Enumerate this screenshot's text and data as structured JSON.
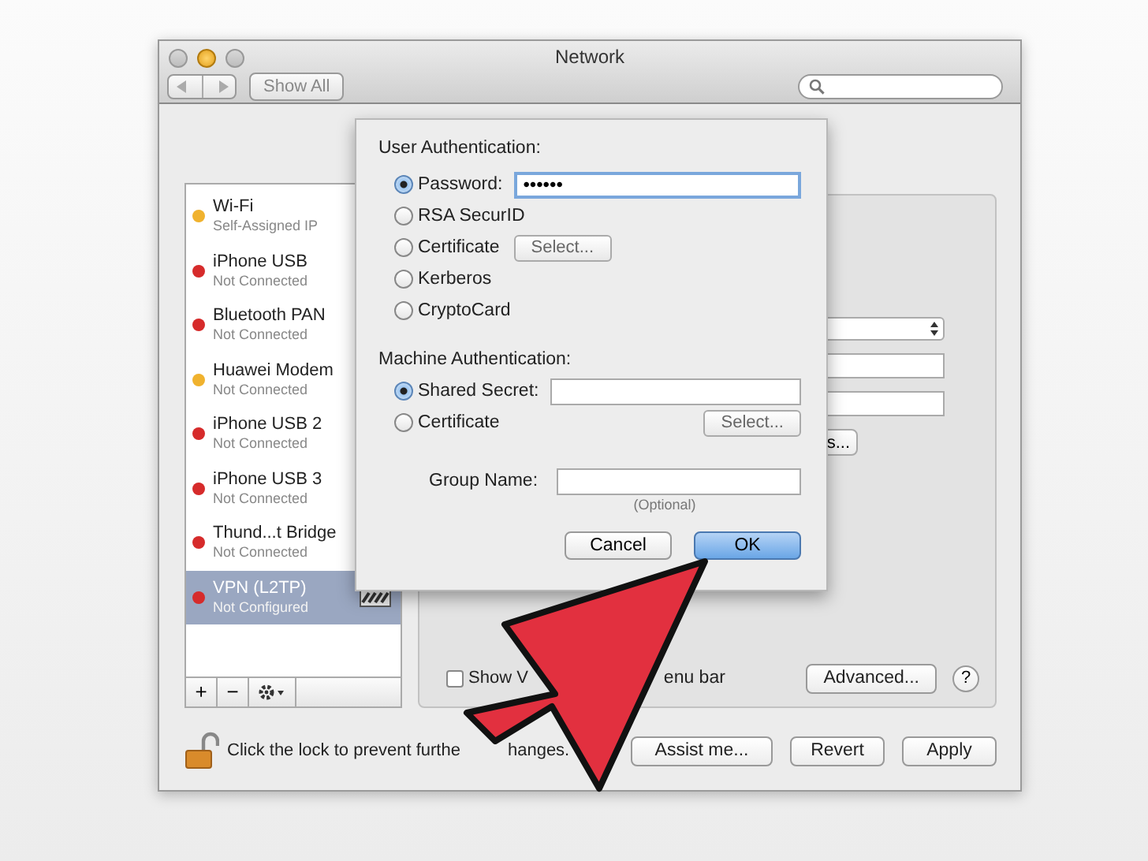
{
  "window": {
    "title": "Network"
  },
  "toolbar": {
    "show_all": "Show All"
  },
  "services": [
    {
      "name": "Wi-Fi",
      "status": "Self-Assigned IP",
      "color": "#f0b22e",
      "selected": false
    },
    {
      "name": "iPhone USB",
      "status": "Not Connected",
      "color": "#d62b2b",
      "selected": false
    },
    {
      "name": "Bluetooth PAN",
      "status": "Not Connected",
      "color": "#d62b2b",
      "selected": false
    },
    {
      "name": "Huawei Modem",
      "status": "Not Connected",
      "color": "#f0b22e",
      "selected": false
    },
    {
      "name": "iPhone USB 2",
      "status": "Not Connected",
      "color": "#d62b2b",
      "selected": false
    },
    {
      "name": "iPhone USB 3",
      "status": "Not Connected",
      "color": "#d62b2b",
      "selected": false
    },
    {
      "name": "Thund...t Bridge",
      "status": "Not Connected",
      "color": "#d62b2b",
      "selected": false
    },
    {
      "name": "VPN (L2TP)",
      "status": "Not Configured",
      "color": "#d62b2b",
      "selected": true
    }
  ],
  "list_buttons": [
    "+",
    "−"
  ],
  "panel": {
    "auth_settings_button": "s...",
    "show_status": {
      "checked": false,
      "label_start": "Show V",
      "label_end": "enu bar"
    },
    "advanced_button": "Advanced...",
    "help_button": "?"
  },
  "footer": {
    "unlocked": true,
    "lock_text_start": "Click the lock to prevent furthe",
    "lock_text_end": "hanges.",
    "buttons": [
      "Assist me...",
      "Revert",
      "Apply"
    ]
  },
  "dialog": {
    "user_authentication": {
      "title": "User Authentication:",
      "options": [
        {
          "label": "Password:",
          "selected": true,
          "kind": "field",
          "value": "••••••"
        },
        {
          "label": "RSA SecurID",
          "selected": false,
          "kind": "plain"
        },
        {
          "label": "Certificate",
          "selected": false,
          "kind": "select",
          "button": "Select..."
        },
        {
          "label": "Kerberos",
          "selected": false,
          "kind": "plain"
        },
        {
          "label": "CryptoCard",
          "selected": false,
          "kind": "plain"
        }
      ]
    },
    "machine_authentication": {
      "title": "Machine Authentication:",
      "options": [
        {
          "label": "Shared Secret:",
          "selected": true,
          "kind": "field"
        },
        {
          "label": "Certificate",
          "selected": false,
          "kind": "select_right",
          "button": "Select..."
        }
      ]
    },
    "group_name": {
      "label": "Group Name:",
      "hint": "(Optional)"
    },
    "buttons": [
      {
        "label": "Cancel",
        "default": false
      },
      {
        "label": "OK",
        "default": true
      }
    ]
  }
}
